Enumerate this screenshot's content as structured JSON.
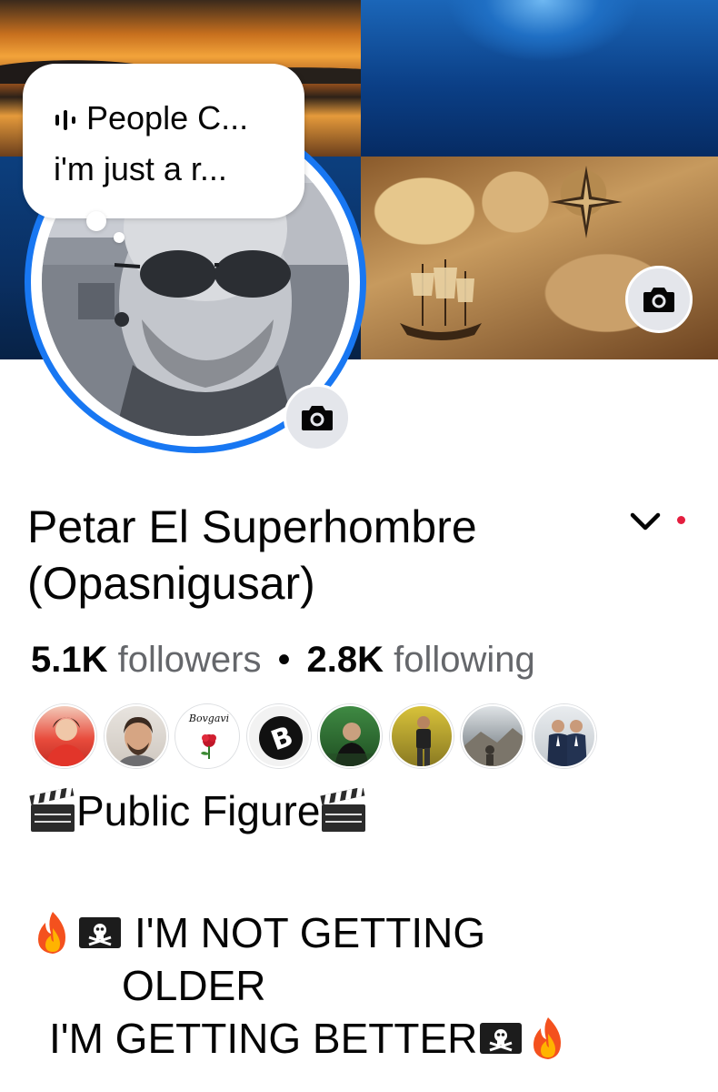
{
  "note": {
    "line1": "People C...",
    "line2": "i'm just a r...",
    "icon": "audio-bars-icon"
  },
  "profile": {
    "name": "Petar El Superhombre (Opasnigusar)",
    "followers_count": "5.1K",
    "followers_label": "followers",
    "separator": "•",
    "following_count": "2.8K",
    "following_label": "following"
  },
  "follower_avatars": [
    {
      "name": "follower-1"
    },
    {
      "name": "follower-2"
    },
    {
      "name": "follower-3",
      "logo_text": "Bovgavi"
    },
    {
      "name": "follower-4",
      "logo_text": "B"
    },
    {
      "name": "follower-5"
    },
    {
      "name": "follower-6"
    },
    {
      "name": "follower-7"
    },
    {
      "name": "follower-8"
    }
  ],
  "bio": {
    "line1": "Public Figure",
    "line2": "I'M NOT GETTING",
    "line3": "OLDER",
    "line4": "I'M GETTING BETTER"
  },
  "colors": {
    "accent": "#1877f2",
    "notification_dot": "#e41e3f",
    "secondary_text": "#65676b"
  }
}
